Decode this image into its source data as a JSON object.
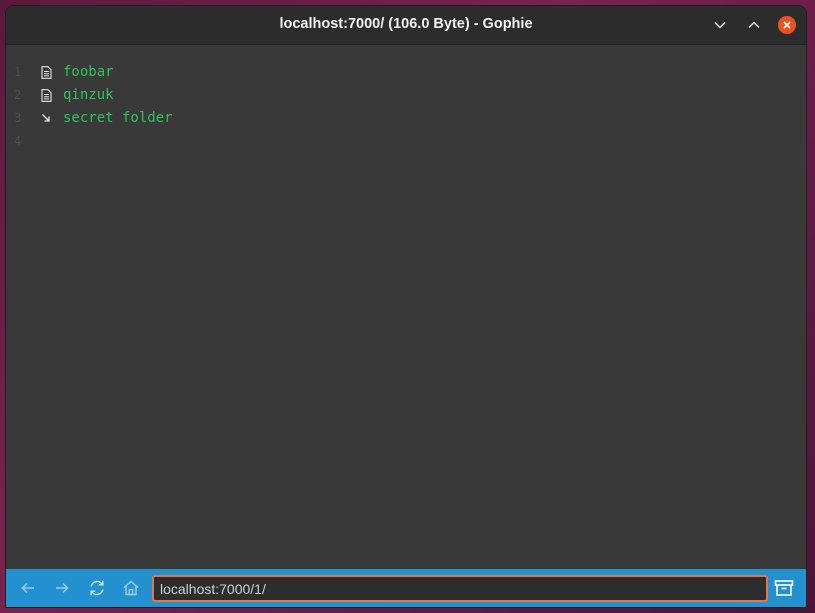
{
  "window": {
    "title": "localhost:7000/ (106.0 Byte) - Gophie"
  },
  "document": {
    "lines": [
      {
        "number": "1",
        "icon": "document-icon",
        "text": "foobar"
      },
      {
        "number": "2",
        "icon": "document-icon",
        "text": "qinzuk"
      },
      {
        "number": "3",
        "icon": "arrow-down-right-icon",
        "text": "secret folder"
      },
      {
        "number": "4",
        "icon": "",
        "text": ""
      }
    ]
  },
  "toolbar": {
    "address_value": "localhost:7000/1/"
  },
  "icons": {
    "back": "arrow-left-icon",
    "forward": "arrow-right-icon",
    "reload": "reload-icon",
    "home": "home-icon",
    "archive": "archive-icon",
    "minimize": "chevron-down-icon",
    "maximize": "chevron-up-icon",
    "close": "close-icon"
  },
  "colors": {
    "link": "#2fc35a",
    "toolbar": "#2391cf",
    "content_bg": "#393939",
    "close_button": "#e95420",
    "input_focus": "#e8744a"
  }
}
